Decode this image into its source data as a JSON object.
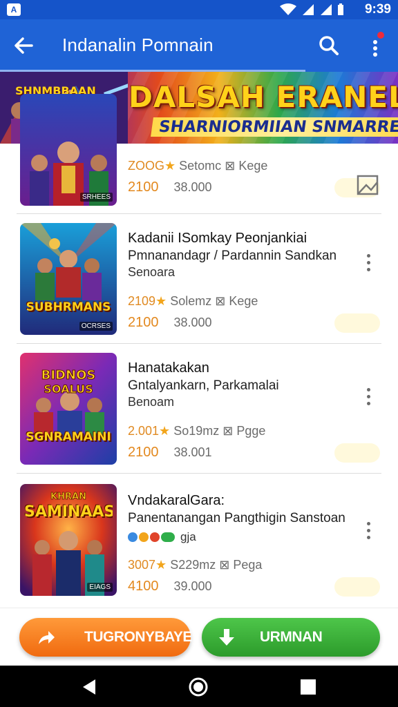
{
  "status_bar": {
    "notification": "A",
    "time": "9:39"
  },
  "app_bar": {
    "title": "Indanalin Pomnain"
  },
  "banner": {
    "art_title": "SHNMBBAAN",
    "headline": "DALSAH ERANELASNI",
    "subheadline": "SHARNIORMIIAN SNMARREI"
  },
  "items": [
    {
      "thumb_title": "",
      "thumb_tag": "SRHEES",
      "name": "",
      "subtitle1": "",
      "subtitle2": "",
      "rating": "ZOOG",
      "size": "Setomc",
      "age": "Kege",
      "price": "2100",
      "old_price": "38.000"
    },
    {
      "thumb_title": "SUBHRMANS",
      "thumb_tag": "OCRSES",
      "name": "Kadanii ISomkay Peonjankiai",
      "subtitle1": "Pmnanandagr / Pardannin Sandkan",
      "subtitle2": "Senoara",
      "rating": "2109",
      "size": "Solemz",
      "age": "Kege",
      "price": "2100",
      "old_price": "38.000"
    },
    {
      "thumb_title": "SGNRAMAINI",
      "thumb_tag": "BIDNOS SOALUS",
      "name": "Hanatakakan",
      "subtitle1": "Gntalyankarn, Parkamalai",
      "subtitle2": "Benoam",
      "rating": "2.001",
      "size": "So19mz",
      "age": "Pgge",
      "price": "2100",
      "old_price": "38.001"
    },
    {
      "thumb_title": "SAMINAAS",
      "thumb_tag": "EIAGS",
      "name": "VndakaralGara:",
      "subtitle1": "Panentanangan Pangthigin Sanstoan",
      "subtitle2": "gja",
      "rating": "3007",
      "size": "S229mz",
      "age": "Pega",
      "price": "4100",
      "old_price": "39.000"
    }
  ],
  "buttons": {
    "share": "TUGRONYBAYE",
    "download": "URMNAN"
  },
  "colors": {
    "primary": "#1f63d6",
    "accent": "#e3891f",
    "share": "#f47a1f",
    "download": "#3aaf39"
  }
}
